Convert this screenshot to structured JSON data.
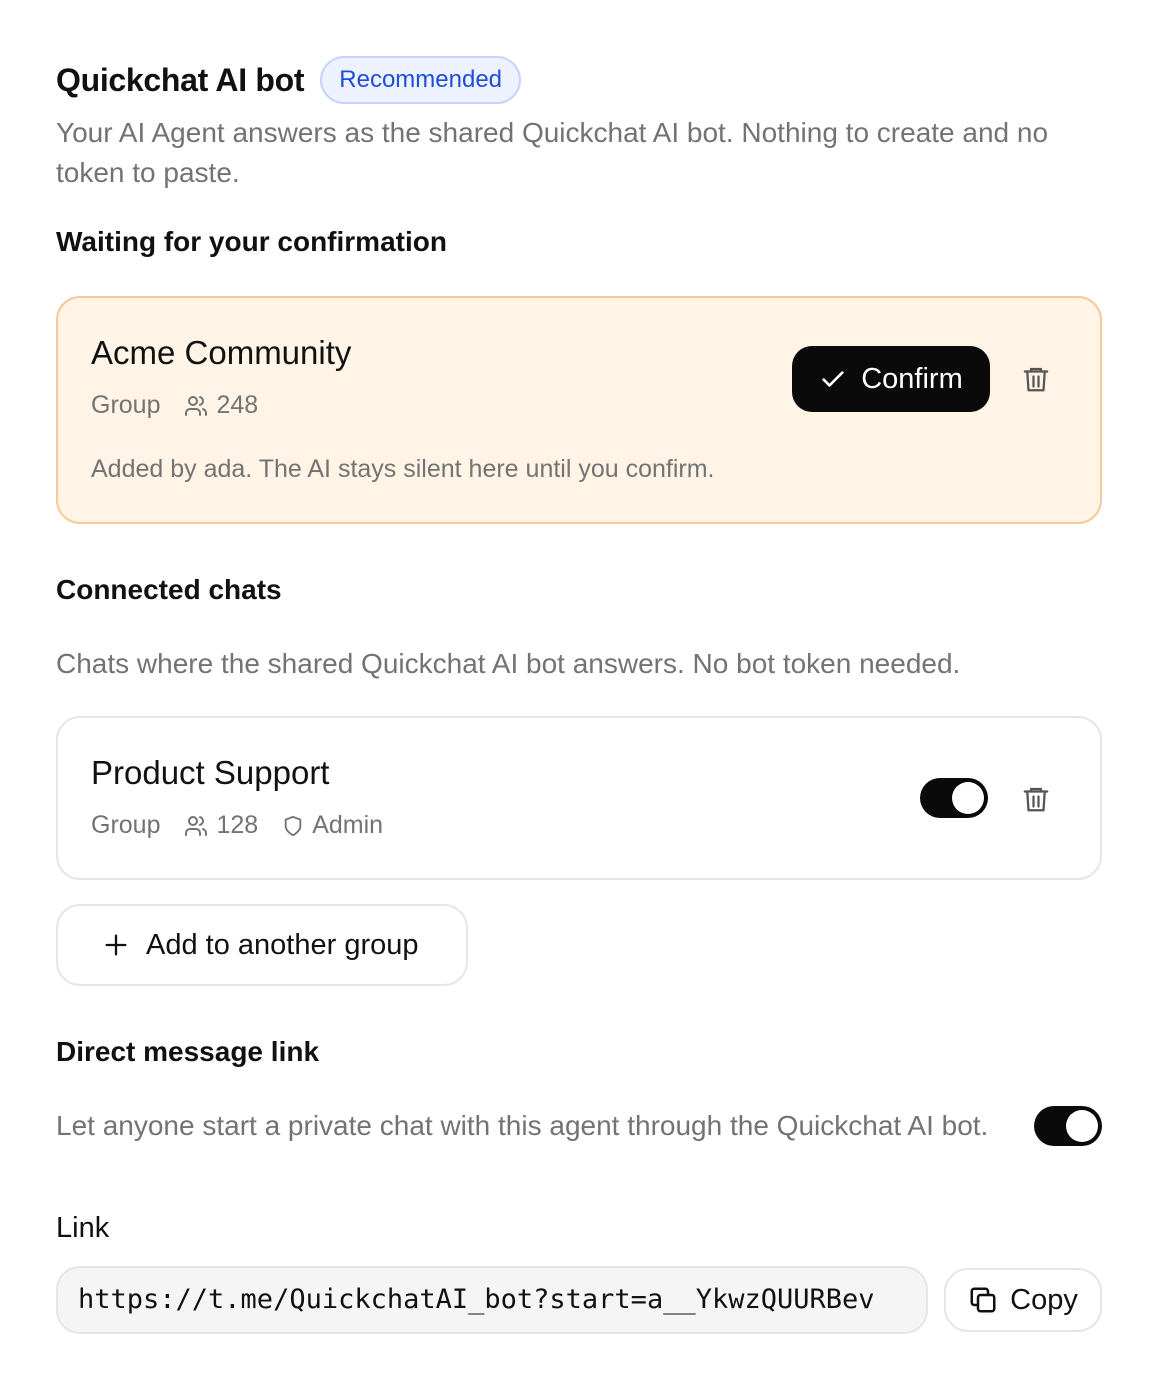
{
  "header": {
    "title": "Quickchat AI bot",
    "badge": "Recommended",
    "description": "Your AI Agent answers as the shared Quickchat AI bot. Nothing to create and no token to paste."
  },
  "pending": {
    "section_title": "Waiting for your confirmation",
    "card": {
      "name": "Acme Community",
      "type": "Group",
      "members": "248",
      "note": "Added by ada. The AI stays silent here until you confirm.",
      "confirm_label": "Confirm"
    }
  },
  "connected": {
    "section_title": "Connected chats",
    "description": "Chats where the shared Quickchat AI bot answers. No bot token needed.",
    "card": {
      "name": "Product Support",
      "type": "Group",
      "members": "128",
      "role": "Admin",
      "enabled": true
    },
    "add_label": "Add to another group"
  },
  "direct_message": {
    "section_title": "Direct message link",
    "description": "Let anyone start a private chat with this agent through the Quickchat AI bot.",
    "enabled": true,
    "link_label": "Link",
    "link_value": "https://t.me/QuickchatAI_bot?start=a__YkwzQUURBev",
    "copy_label": "Copy"
  },
  "icons": {
    "members": "users-icon",
    "admin": "shield-icon",
    "delete": "trash-icon",
    "confirm": "check-icon",
    "add": "plus-icon",
    "copy": "copy-icon"
  },
  "colors": {
    "badge_text": "#1d4ed8",
    "pending_bg": "#fff4e6",
    "pending_border": "#f6c998",
    "primary": "#0a0a0a",
    "muted_text": "#737373"
  }
}
